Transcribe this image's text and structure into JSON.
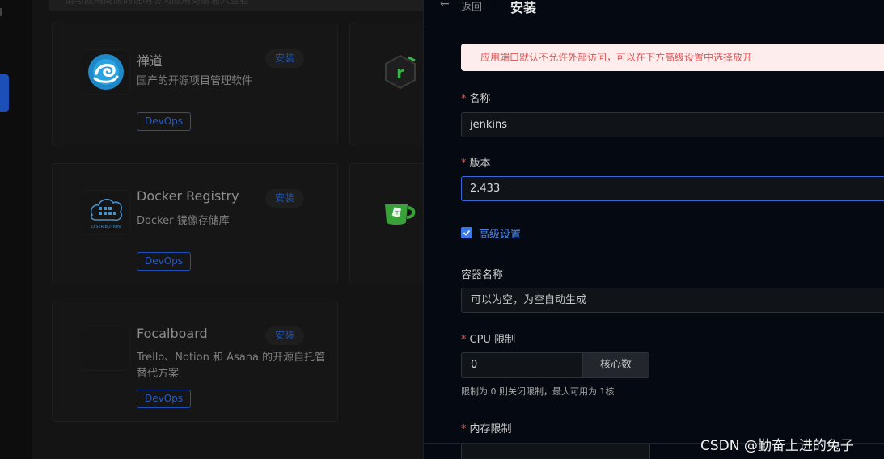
{
  "background": {
    "search_text": "请与应用商店的说明访问应用商店输入查看",
    "apps": [
      {
        "title": "禅道",
        "desc": "国产的开源项目管理软件",
        "install": "安装",
        "tag": "DevOps"
      },
      {
        "title": "Docker Registry",
        "desc": "Docker 镜像存储库",
        "install": "安装",
        "tag": "DevOps"
      },
      {
        "title": "Focalboard",
        "desc": "Trello、Notion 和 Asana 的开源自托管替代方案",
        "install": "安装",
        "tag": "DevOps"
      }
    ],
    "logo_texts": {
      "distribution": "DISTRIBUTION"
    }
  },
  "drawer": {
    "back_label": "返回",
    "title": "安装",
    "alert": "应用端口默认不允许外部访问，可以在下方高级设置中选择放开",
    "form": {
      "name_label": "名称",
      "name_value": "jenkins",
      "version_label": "版本",
      "version_value": "2.433",
      "advanced_label": "高级设置",
      "advanced_checked": true,
      "container_label": "容器名称",
      "container_placeholder": "可以为空，为空自动生成",
      "cpu_label": "CPU 限制",
      "cpu_value": "0",
      "cpu_unit": "核心数",
      "cpu_hint": "限制为 0 则关闭限制，最大可用为 1核",
      "mem_label": "内存限制"
    }
  },
  "watermark": "CSDN @勤奋上进的兔子",
  "colors": {
    "accent": "#3a78f0",
    "danger": "#f05454",
    "alert_bg": "#fdeded",
    "drawer_bg": "#050a12"
  }
}
